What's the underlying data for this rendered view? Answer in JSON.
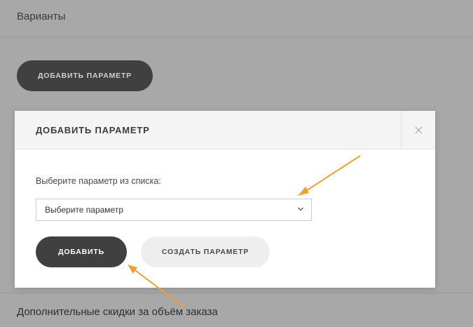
{
  "page": {
    "section_title": "Варианты",
    "add_param_button": "ДОБАВИТЬ ПАРАМЕТР",
    "bottom_section_title": "Дополнительные скидки за объём заказа"
  },
  "modal": {
    "title": "ДОБАВИТЬ ПАРАМЕТР",
    "close_icon": "close-icon",
    "select_label": "Выберите параметр из списка:",
    "select_value": "Выберите параметр",
    "add_button": "ДОБАВИТЬ",
    "create_button": "СОЗДАТЬ ПАРАМЕТР"
  },
  "colors": {
    "overlay": "#a8a8a8",
    "dark_button": "#404040",
    "arrow": "#f0a030"
  }
}
